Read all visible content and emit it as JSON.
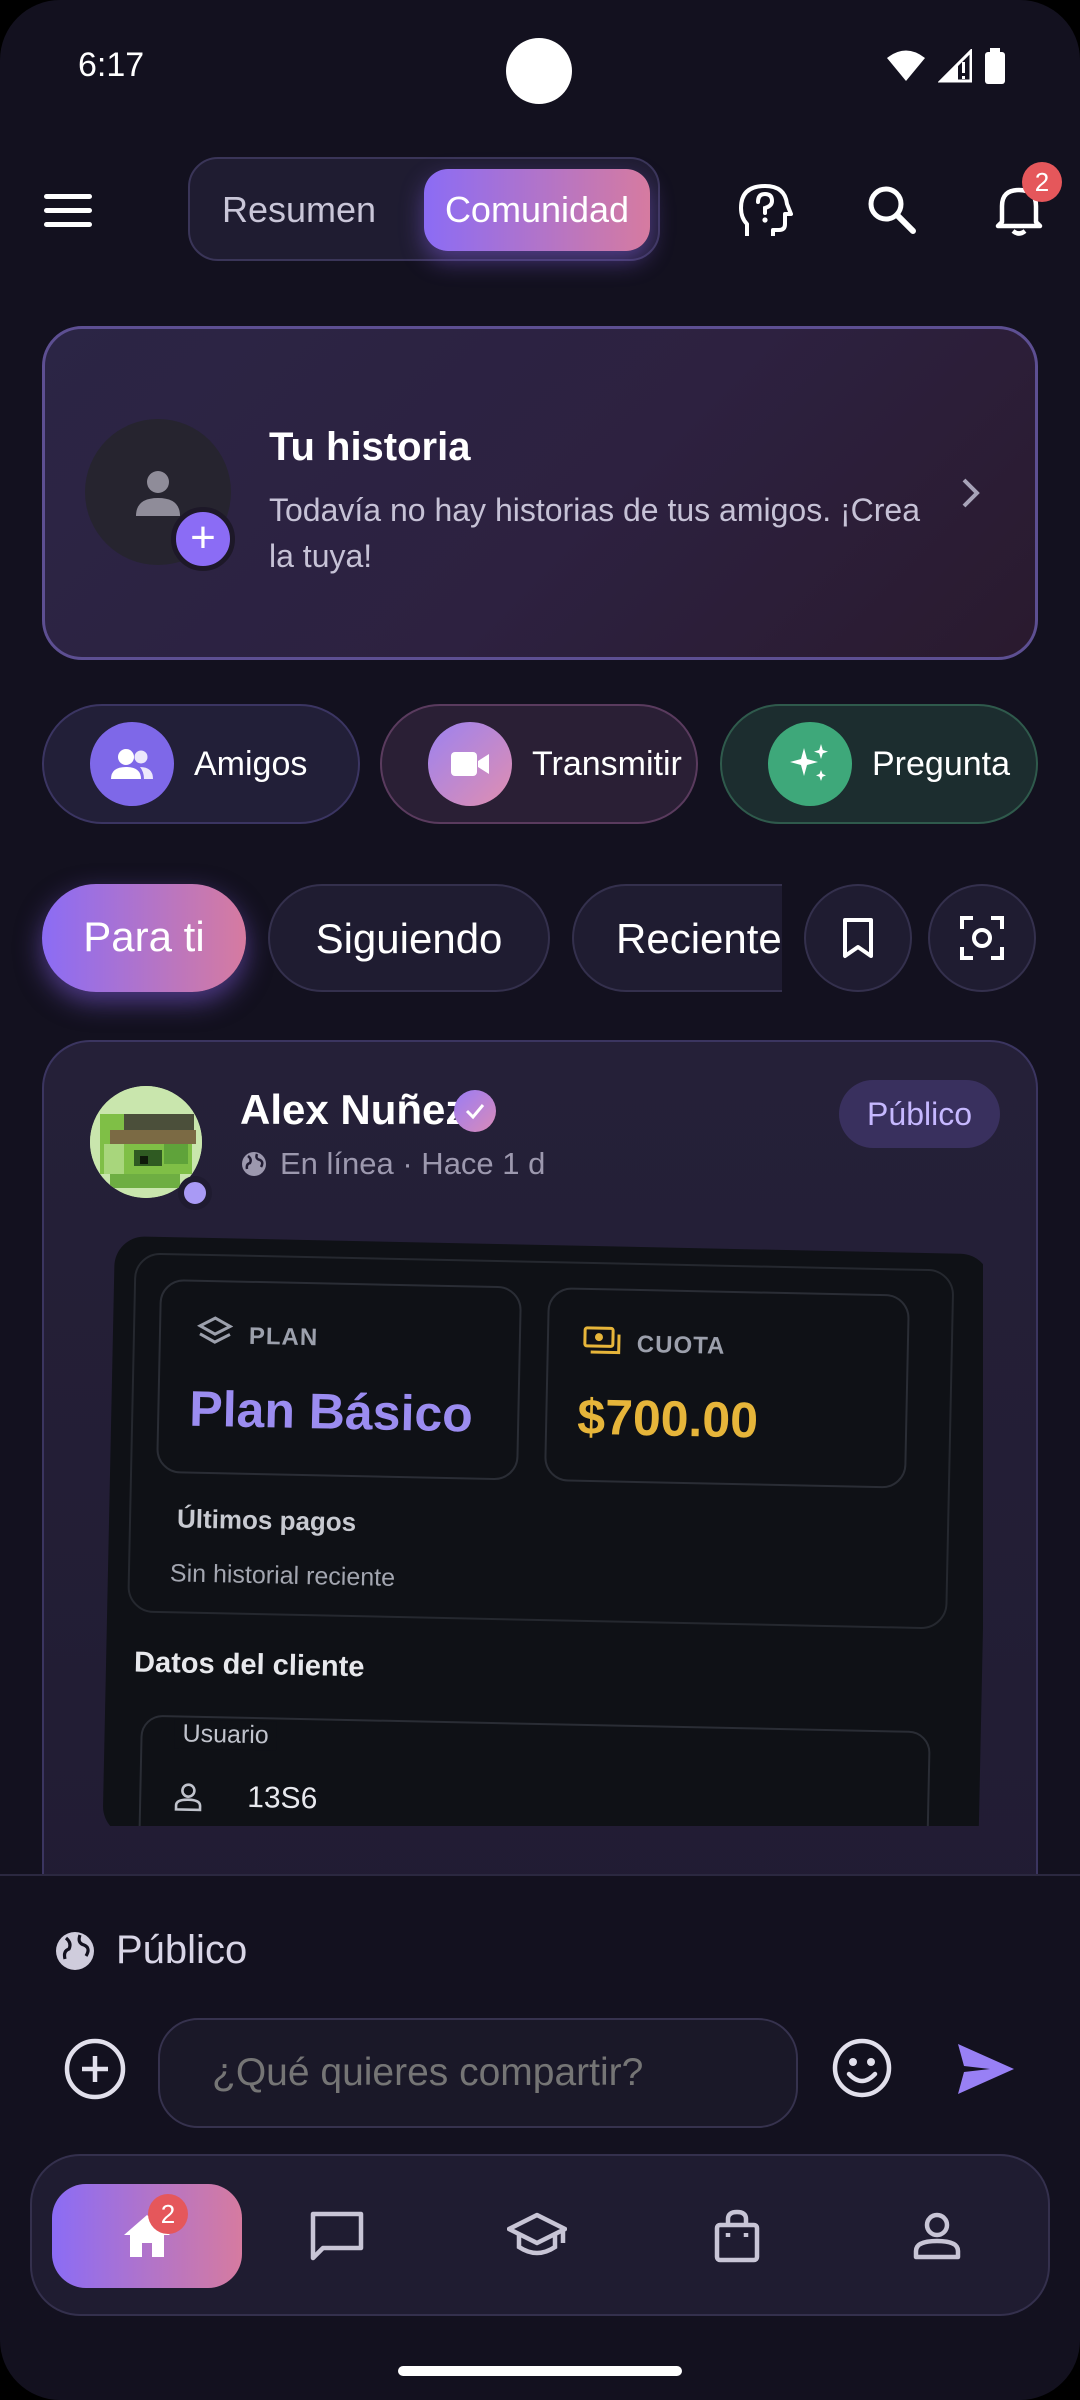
{
  "status_bar": {
    "time": "6:17"
  },
  "header": {
    "segments": [
      "Resumen",
      "Comunidad"
    ],
    "active_segment": "Comunidad",
    "notification_count": "2"
  },
  "story": {
    "title": "Tu historia",
    "subtitle": "Todavía no hay historias de tus amigos. ¡Crea la tuya!"
  },
  "quick_actions": [
    {
      "label": "Amigos",
      "icon": "people-icon"
    },
    {
      "label": "Transmitir",
      "icon": "video-icon"
    },
    {
      "label": "Pregunta",
      "icon": "sparkles-icon"
    }
  ],
  "feed_tabs": [
    "Para ti",
    "Siguiendo",
    "Reciente"
  ],
  "active_feed_tab": "Para ti",
  "post": {
    "author": "Alex Nuñez",
    "status": "En línea · Hace 1 d",
    "visibility": "Público",
    "image": {
      "plan_label": "PLAN",
      "plan_value": "Plan Básico",
      "cuota_label": "CUOTA",
      "cuota_value": "$700.00",
      "payments_title": "Últimos pagos",
      "payments_empty": "Sin historial reciente",
      "client_title": "Datos del cliente",
      "user_field_label": "Usuario",
      "user_field_value": "13S6"
    }
  },
  "composer": {
    "visibility": "Público",
    "placeholder": "¿Qué quieres compartir?"
  },
  "bottom_nav": {
    "items": [
      "home-icon",
      "chat-icon",
      "school-icon",
      "shopping-bag-icon",
      "profile-icon"
    ],
    "home_badge": "2"
  },
  "colors": {
    "background": "#13111f",
    "accent_start": "#8b6cf5",
    "accent_end": "#d67ba0",
    "badge": "#e5575b",
    "cuota_gold": "#e6b53a"
  }
}
